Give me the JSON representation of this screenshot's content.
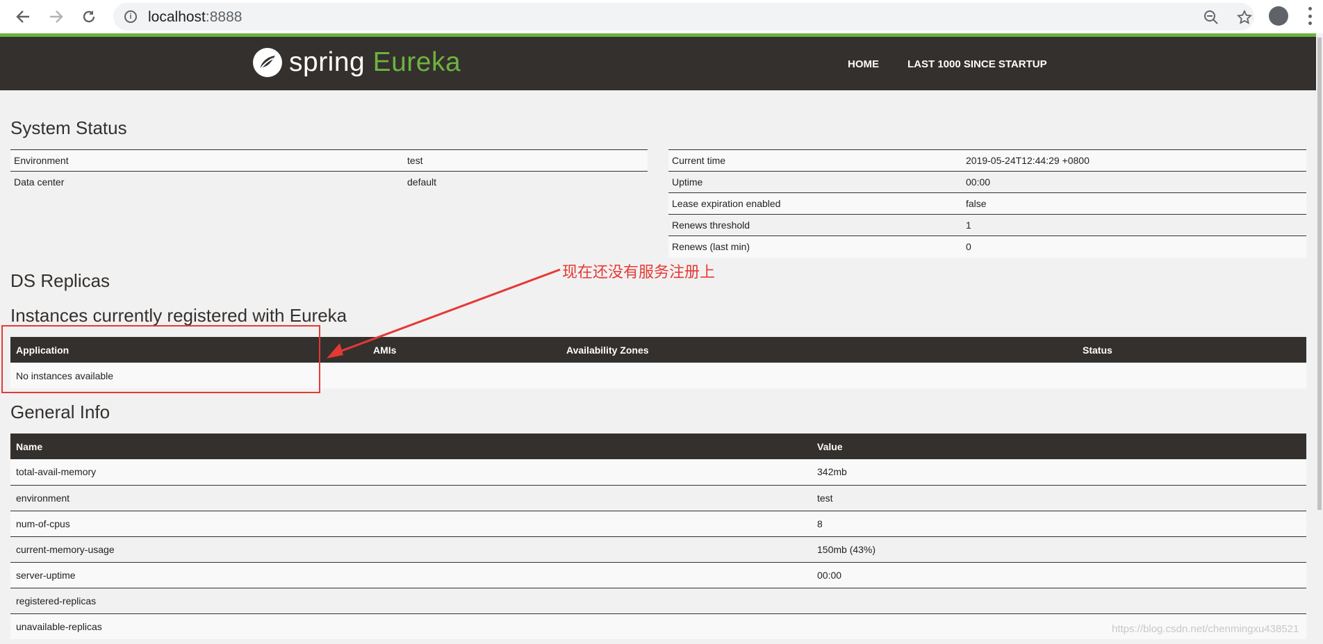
{
  "browser": {
    "url_host": "localhost",
    "url_port": ":8888"
  },
  "header": {
    "logo_spring": "spring",
    "logo_eureka": "Eureka",
    "nav": [
      "HOME",
      "LAST 1000 SINCE STARTUP"
    ]
  },
  "system_status": {
    "title": "System Status",
    "left": [
      {
        "key": "Environment",
        "value": "test"
      },
      {
        "key": "Data center",
        "value": "default"
      }
    ],
    "right": [
      {
        "key": "Current time",
        "value": "2019-05-24T12:44:29 +0800"
      },
      {
        "key": "Uptime",
        "value": "00:00"
      },
      {
        "key": "Lease expiration enabled",
        "value": "false"
      },
      {
        "key": "Renews threshold",
        "value": "1"
      },
      {
        "key": "Renews (last min)",
        "value": "0"
      }
    ]
  },
  "ds_replicas": {
    "title": "DS Replicas"
  },
  "instances": {
    "title": "Instances currently registered with Eureka",
    "columns": [
      "Application",
      "AMIs",
      "Availability Zones",
      "Status"
    ],
    "empty_text": "No instances available"
  },
  "annotation": {
    "text": "现在还没有服务注册上",
    "color": "#e53935"
  },
  "general_info": {
    "title": "General Info",
    "columns": [
      "Name",
      "Value"
    ],
    "rows": [
      {
        "name": "total-avail-memory",
        "value": "342mb"
      },
      {
        "name": "environment",
        "value": "test"
      },
      {
        "name": "num-of-cpus",
        "value": "8"
      },
      {
        "name": "current-memory-usage",
        "value": "150mb (43%)"
      },
      {
        "name": "server-uptime",
        "value": "00:00"
      },
      {
        "name": "registered-replicas",
        "value": ""
      },
      {
        "name": "unavailable-replicas",
        "value": ""
      }
    ]
  },
  "watermark": "https://blog.csdn.net/chenmingxu438521",
  "colors": {
    "brand_green": "#6db33f",
    "header_dark": "#34302d"
  }
}
